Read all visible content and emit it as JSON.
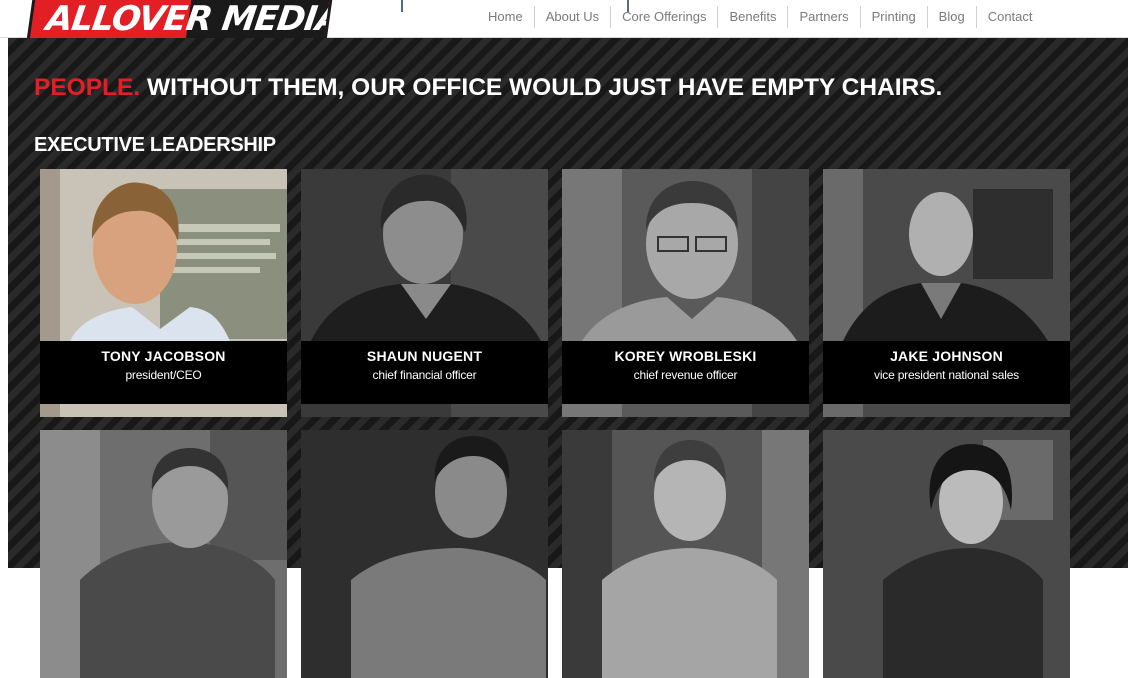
{
  "header": {
    "logo_text": "ALLOVER MEDIA",
    "nav": [
      "Home",
      "About Us",
      "Core Offerings",
      "Benefits",
      "Partners",
      "Printing",
      "Blog",
      "Contact"
    ]
  },
  "hero": {
    "accent": "PEOPLE.",
    "headline": "WITHOUT THEM, OUR OFFICE WOULD JUST HAVE EMPTY CHAIRS."
  },
  "section_title": "EXECUTIVE LEADERSHIP",
  "team": [
    {
      "name": "TONY JACOBSON",
      "role": "president/CEO"
    },
    {
      "name": "SHAUN NUGENT",
      "role": "chief financial officer"
    },
    {
      "name": "KOREY WROBLESKI",
      "role": "chief revenue officer"
    },
    {
      "name": "JAKE JOHNSON",
      "role": "vice president national sales"
    }
  ],
  "colors": {
    "brand_red": "#e31f26",
    "background": "#1f1f1f",
    "caption_bg": "#000000"
  }
}
